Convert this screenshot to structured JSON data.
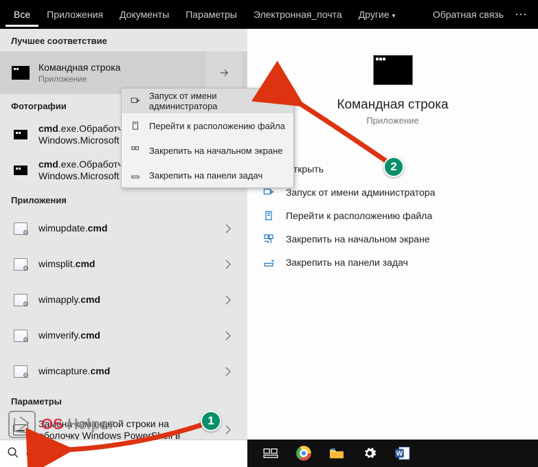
{
  "topbar": {
    "tabs": [
      "Все",
      "Приложения",
      "Документы",
      "Параметры",
      "Электронная_почта",
      "Другие"
    ],
    "feedback": "Обратная связь",
    "more": "⋯"
  },
  "left": {
    "best_label": "Лучшее соответствие",
    "best": {
      "title": "Командная строка",
      "sub": "Приложение"
    },
    "photos_label": "Фотографии",
    "photos": [
      {
        "pre": "",
        "bold": "cmd",
        "post": ".exe.Обработчи",
        "line2": "Windows.Microsoft"
      },
      {
        "pre": "",
        "bold": "cmd",
        "post": ".exe.Обработчик команд",
        "line2": "Windows.Microsoft"
      }
    ],
    "apps_label": "Приложения",
    "apps": [
      {
        "pre": "wimupdate.",
        "bold": "cmd"
      },
      {
        "pre": "wimsplit.",
        "bold": "cmd"
      },
      {
        "pre": "wimapply.",
        "bold": "cmd"
      },
      {
        "pre": "wimverify.",
        "bold": "cmd"
      },
      {
        "pre": "wimcapture.",
        "bold": "cmd"
      }
    ],
    "params_label": "Параметры",
    "params": [
      {
        "line1": "Замена командной строки на",
        "line2": "оболочку Windows PowerShell в"
      }
    ]
  },
  "context_menu": {
    "items": [
      "Запуск от имени администратора",
      "Перейти к расположению файла",
      "Закрепить на начальном экране",
      "Закрепить на панели задач"
    ]
  },
  "detail": {
    "title": "Командная строка",
    "sub": "Приложение",
    "actions": [
      "Открыть",
      "Запуск от имени администратора",
      "Перейти к расположению файла",
      "Закрепить на начальном экране",
      "Закрепить на панели задач"
    ]
  },
  "search": {
    "value": "cmd"
  },
  "watermark": {
    "brand_left": "OS",
    "brand_right": "Helper"
  },
  "annotations": {
    "b1": "1",
    "b2": "2"
  }
}
